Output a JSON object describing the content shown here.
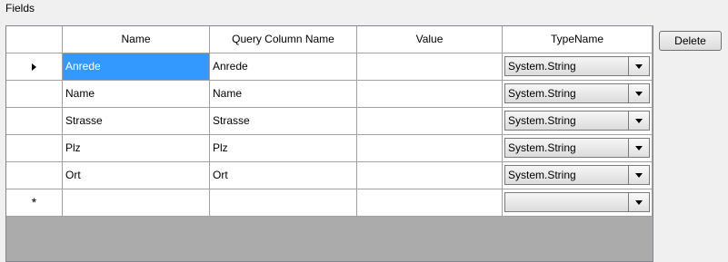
{
  "group": {
    "label": "Fields"
  },
  "grid": {
    "columns": [
      "Name",
      "Query Column Name",
      "Value",
      "TypeName"
    ],
    "rows": [
      {
        "name": "Anrede",
        "query": "Anrede",
        "value": "",
        "type": "System.String",
        "indicator": "current-row-arrow",
        "selected": "name"
      },
      {
        "name": "Name",
        "query": "Name",
        "value": "",
        "type": "System.String"
      },
      {
        "name": "Strasse",
        "query": "Strasse",
        "value": "",
        "type": "System.String"
      },
      {
        "name": "Plz",
        "query": "Plz",
        "value": "",
        "type": "System.String"
      },
      {
        "name": "Ort",
        "query": "Ort",
        "value": "",
        "type": "System.String"
      }
    ],
    "new_row": {
      "indicator": "*",
      "type": ""
    }
  },
  "buttons": {
    "delete": "Delete"
  },
  "colors": {
    "selection": "#3399ff",
    "grid_background": "#ababab"
  }
}
